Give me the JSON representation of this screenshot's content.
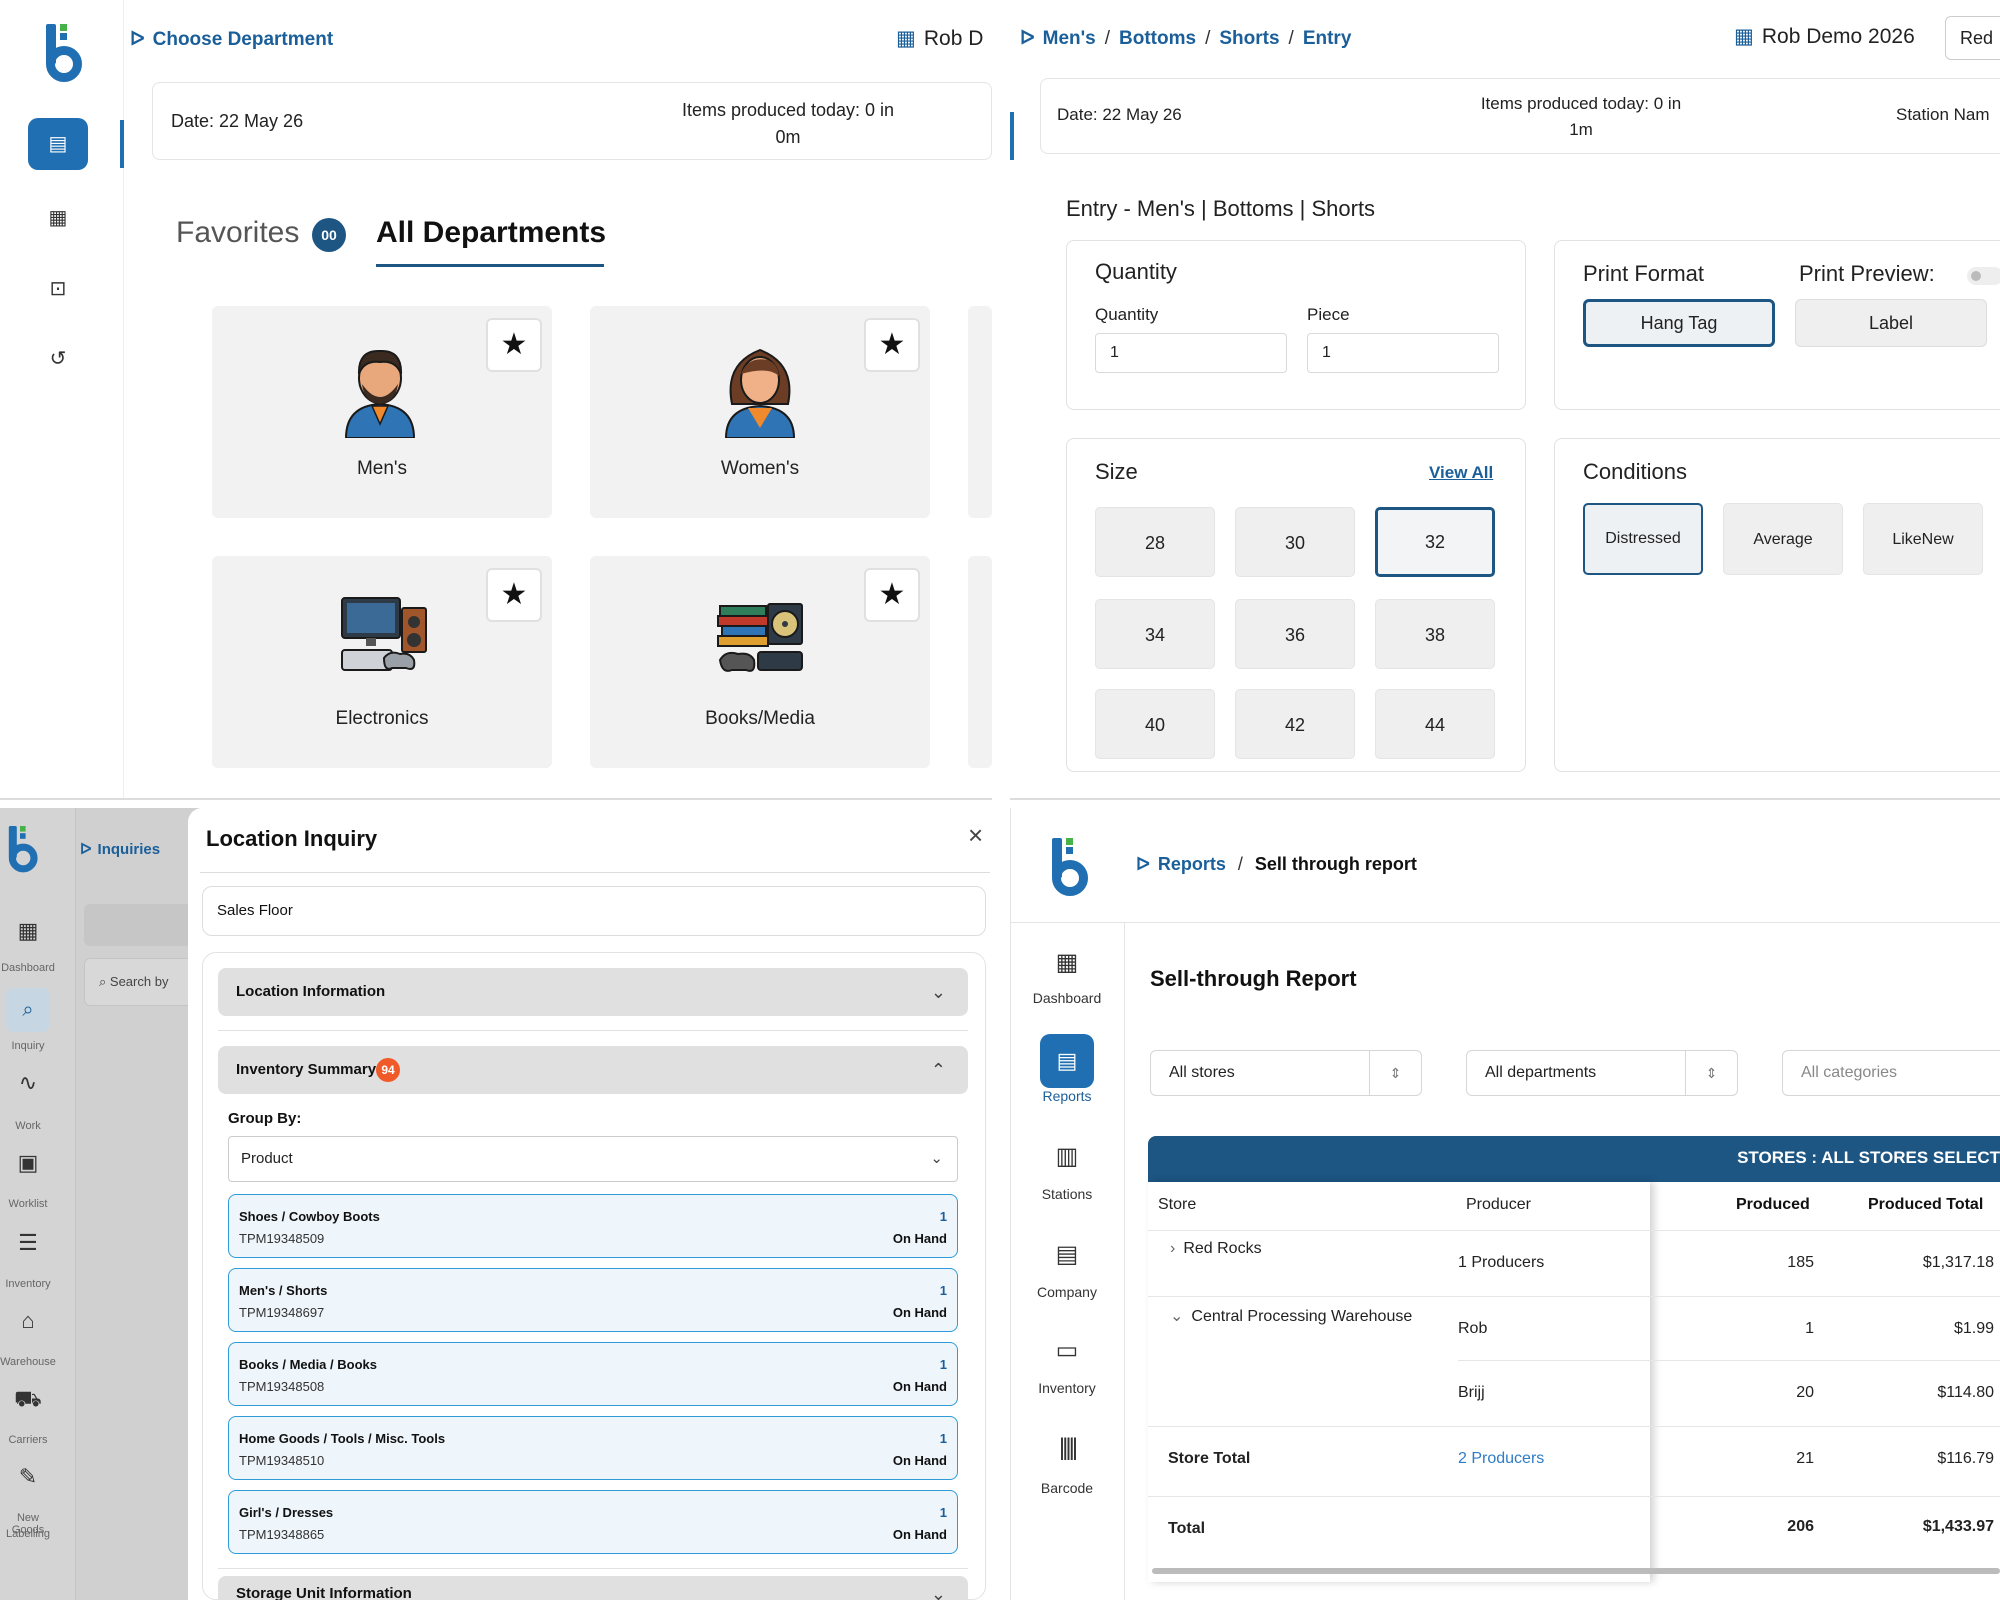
{
  "q1": {
    "breadcrumb": "Choose Department",
    "user": "Rob D",
    "date": "Date: 22 May 26",
    "items_produced_line1": "Items produced today: 0 in",
    "items_produced_line2": "0m",
    "tab_favorites": "Favorites",
    "favorites_count": "00",
    "tab_all": "All Departments",
    "departments": [
      {
        "label": "Men's"
      },
      {
        "label": "Women's"
      },
      {
        "label": "Electronics"
      },
      {
        "label": "Books/Media"
      }
    ]
  },
  "q2": {
    "breadcrumbs": [
      "Men's",
      "Bottoms",
      "Shorts",
      "Entry"
    ],
    "user": "Rob Demo 2026",
    "user_btn": "Red",
    "date": "Date: 22 May 26",
    "items_produced_line1": "Items produced today: 0 in",
    "items_produced_line2": "1m",
    "station": "Station Nam",
    "entry_title": "Entry - Men's | Bottoms | Shorts",
    "quantity_title": "Quantity",
    "quantity_label": "Quantity",
    "quantity_value": "1",
    "piece_label": "Piece",
    "piece_value": "1",
    "print_format_title": "Print Format",
    "print_preview_title": "Print Preview:",
    "hang_tag": "Hang Tag",
    "label": "Label",
    "size_title": "Size",
    "view_all": "View All",
    "sizes": [
      "28",
      "30",
      "32",
      "34",
      "36",
      "38",
      "40",
      "42",
      "44"
    ],
    "selected_size": "32",
    "conditions_title": "Conditions",
    "conditions": [
      "Distressed",
      "Average",
      "LikeNew"
    ],
    "selected_condition": "Distressed"
  },
  "q3": {
    "breadcrumb": "Inquiries",
    "search_placeholder": "Search by",
    "sidebar": [
      "Dashboard",
      "Inquiry",
      "Work",
      "Worklist",
      "Inventory",
      "Warehouse",
      "Carriers",
      "New Goods",
      "Labelling"
    ],
    "modal_title": "Location Inquiry",
    "location": "Sales Floor",
    "location_info": "Location Information",
    "inventory_summary": "Inventory Summary",
    "inventory_count": "94",
    "group_by_label": "Group By:",
    "group_by_value": "Product",
    "items": [
      {
        "title": "Shoes / Cowboy Boots",
        "code": "TPM19348509",
        "qty": "1",
        "status": "On Hand"
      },
      {
        "title": "Men's / Shorts",
        "code": "TPM19348697",
        "qty": "1",
        "status": "On Hand"
      },
      {
        "title": "Books / Media / Books",
        "code": "TPM19348508",
        "qty": "1",
        "status": "On Hand"
      },
      {
        "title": "Home Goods / Tools / Misc. Tools",
        "code": "TPM19348510",
        "qty": "1",
        "status": "On Hand"
      },
      {
        "title": "Girl's / Dresses",
        "code": "TPM19348865",
        "qty": "1",
        "status": "On Hand"
      }
    ],
    "storage_unit": "Storage Unit Information"
  },
  "q4": {
    "breadcrumb_link": "Reports",
    "breadcrumb_current": "Sell through report",
    "nav": [
      "Dashboard",
      "Reports",
      "Stations",
      "Company",
      "Inventory",
      "Barcode"
    ],
    "title": "Sell-through Report",
    "filter_stores": "All stores",
    "filter_departments": "All departments",
    "filter_categories": "All categories",
    "banner": "STORES : ALL STORES SELECT",
    "col_store": "Store",
    "col_producer": "Producer",
    "col_produced": "Produced",
    "col_produced_total": "Produced Total",
    "rows": [
      {
        "store": "Red Rocks",
        "producer": "1 Producers",
        "produced": "185",
        "total": "$1,317.18"
      },
      {
        "store": "Central Processing Warehouse",
        "producer": "Rob",
        "produced": "1",
        "total": "$1.99"
      },
      {
        "store": "",
        "producer": "Brijj",
        "produced": "20",
        "total": "$114.80"
      }
    ],
    "store_total_label": "Store Total",
    "store_total_producer": "2 Producers",
    "store_total_produced": "21",
    "store_total_value": "$116.79",
    "total_label": "Total",
    "total_produced": "206",
    "total_value": "$1,433.97"
  },
  "colors": {
    "primary": "#1b5f9a",
    "accent_blue": "#1f6fb2",
    "badge": "#f05a28",
    "banner": "#1d5583"
  }
}
